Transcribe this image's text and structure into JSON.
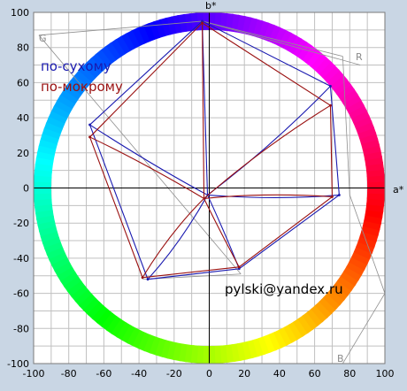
{
  "chart_data": {
    "type": "line",
    "title": "",
    "xlabel": "a*",
    "ylabel": "b*",
    "xlim": [
      -100,
      100
    ],
    "ylim": [
      -100,
      100
    ],
    "xticks": [
      -100,
      -80,
      -60,
      -40,
      -20,
      0,
      20,
      40,
      60,
      80,
      100
    ],
    "yticks": [
      -100,
      -80,
      -60,
      -40,
      -20,
      0,
      20,
      40,
      60,
      80,
      100
    ],
    "grid": true,
    "background": "#ffffff",
    "outer_background": "#c9d6e4",
    "grid_color": "#c0c0c0",
    "hue_ring": {
      "inner_radius": 90,
      "outer_radius": 100
    },
    "corner_labels": [
      "G",
      "R",
      "B"
    ],
    "annotation": "pylski@yandex.ru",
    "series": [
      {
        "name": "по-сухому",
        "color": "#1a1ab0",
        "polygon": [
          [
            -4,
            95
          ],
          [
            69,
            58
          ],
          [
            74,
            -4
          ],
          [
            17,
            -46
          ],
          [
            -35,
            -52
          ],
          [
            -68,
            36
          ]
        ],
        "inner_points": [
          [
            -3,
            92
          ],
          [
            -1,
            -4
          ]
        ]
      },
      {
        "name": "по-мокрому",
        "color": "#9a1010",
        "polygon": [
          [
            -4,
            94
          ],
          [
            69,
            47
          ],
          [
            70,
            -5
          ],
          [
            17,
            -45
          ],
          [
            -38,
            -51
          ],
          [
            -68,
            29
          ]
        ],
        "inner_points": [
          [
            -4,
            92
          ],
          [
            -3,
            -6
          ]
        ]
      }
    ]
  }
}
